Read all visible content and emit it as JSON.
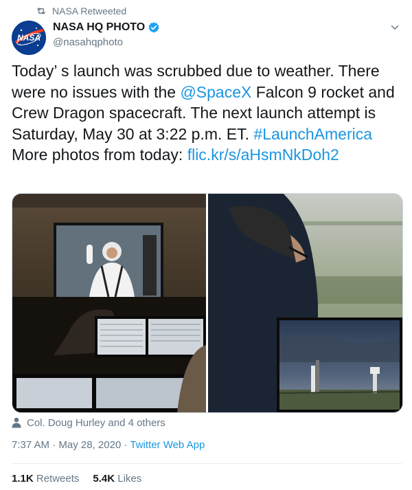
{
  "retweet_header": {
    "label": "NASA Retweeted",
    "icon": "retweet-icon"
  },
  "author": {
    "name": "NASA HQ PHOTO",
    "handle": "@nasahqphoto",
    "verified": true,
    "avatar_icon": "nasa-meatball-logo",
    "avatar_logo_text": "NASA"
  },
  "tweet": {
    "text_part1": "Today’ s launch was scrubbed due to weather. There were no issues with the ",
    "mention": "@SpaceX",
    "text_part2": " Falcon 9 rocket and Crew Dragon spacecraft. The next launch attempt is Saturday, May 30 at 3:22 p.m. ET. ",
    "hashtag": "#LaunchAmerica",
    "text_part3": " More photos from today: ",
    "link": "flic.kr/s/aHsmNkDoh2"
  },
  "media": [
    {
      "description": "Control room with monitor showing astronaut waving"
    },
    {
      "description": "Man in foreground looking at screen showing launch pad under storm clouds"
    }
  ],
  "tagged": {
    "icon": "person-icon",
    "label": "Col. Doug Hurley and 4 others"
  },
  "meta": {
    "time": "7:37 AM",
    "separator": " · ",
    "date": "May 28, 2020",
    "app": "Twitter Web App"
  },
  "stats": {
    "retweets_count": "1.1K",
    "retweets_label": "Retweets",
    "likes_count": "5.4K",
    "likes_label": "Likes"
  },
  "colors": {
    "link": "#1b95e0",
    "muted": "#657786",
    "verified": "#1da1f2"
  }
}
